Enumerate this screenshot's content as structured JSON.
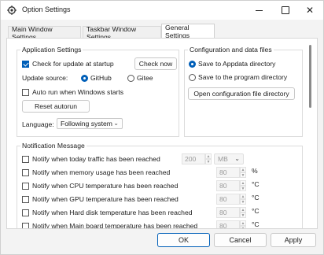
{
  "window": {
    "title": "Option Settings",
    "accent": "#005fb8"
  },
  "tabs": [
    {
      "label": "Main Window Settings"
    },
    {
      "label": "Taskbar Window Settings"
    },
    {
      "label": "General Settings"
    }
  ],
  "application": {
    "title": "Application Settings",
    "check_update": {
      "label": "Check for update at startup",
      "checked": true
    },
    "check_now": "Check now",
    "update_source": {
      "label": "Update source:",
      "options": [
        "GitHub",
        "Gitee"
      ],
      "selected": "GitHub"
    },
    "auto_run": {
      "label": "Auto run when Windows starts",
      "checked": false
    },
    "reset_autorun": "Reset autorun",
    "language": {
      "label": "Language:",
      "value": "Following system"
    }
  },
  "config": {
    "title": "Configuration and data files",
    "options": [
      "Save to Appdata directory",
      "Save to the program directory"
    ],
    "selected": "Save to Appdata directory",
    "open_dir": "Open configuration file directory"
  },
  "notification": {
    "title": "Notification Message",
    "items": [
      {
        "label": "Notify when today traffic has been reached",
        "value": "200",
        "unit": "MB"
      },
      {
        "label": "Notify when memory usage has been reached",
        "value": "80",
        "unit": "%"
      },
      {
        "label": "Notify when CPU temperature has been reached",
        "value": "80",
        "unit": "°C"
      },
      {
        "label": "Notify when GPU temperature has been reached",
        "value": "80",
        "unit": "°C"
      },
      {
        "label": "Notify when Hard disk temperature has been reached",
        "value": "80",
        "unit": "°C"
      },
      {
        "label": "Notify when Main board temperature has been reached",
        "value": "80",
        "unit": "°C"
      }
    ]
  },
  "footer": {
    "ok": "OK",
    "cancel": "Cancel",
    "apply": "Apply"
  }
}
